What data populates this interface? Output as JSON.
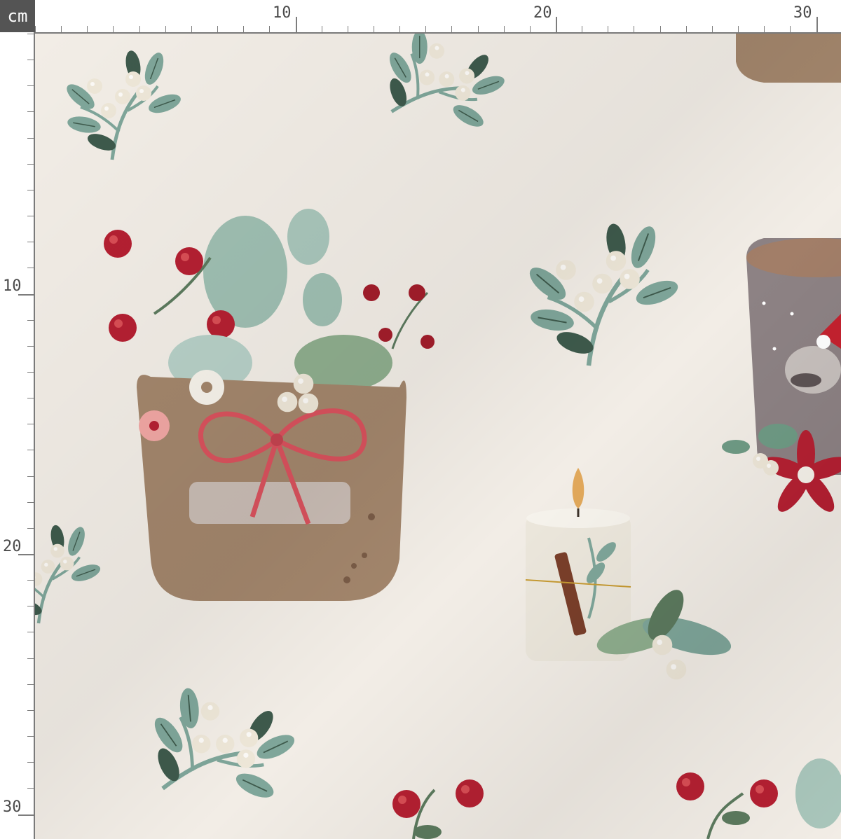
{
  "ruler": {
    "unit_label": "cm",
    "top_labels": [
      "10",
      "20",
      "30"
    ],
    "left_labels": [
      "10",
      "20",
      "30"
    ]
  },
  "swatch": {
    "motif_icons": [
      "mistletoe-sprig-icon",
      "flower-basket-icon",
      "candle-icon",
      "mug-icon",
      "red-berries-icon",
      "poinsettia-icon"
    ],
    "colors": {
      "background": "#f2ede6",
      "leaf_green": "#7fa69a",
      "leaf_dark": "#3e5a4c",
      "berry_white": "#eee7d8",
      "berry_red": "#b52032",
      "basket": "#a3866c",
      "ribbon": "#d9525d",
      "mug": "#8d8284",
      "candle": "#ece7dc"
    }
  }
}
